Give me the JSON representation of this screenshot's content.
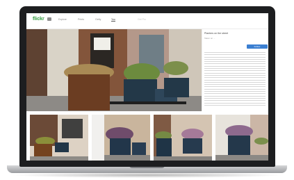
{
  "app": {
    "logo_text": "flickr"
  },
  "nav": {
    "items": [
      "Explore",
      "Prints",
      "Getty",
      "You",
      "Get Pro"
    ],
    "active_index": 3
  },
  "photo": {
    "title": "Planters on the street",
    "subtitle": "Taken on ...",
    "button_label": "Follow"
  },
  "thumbnails": [
    "thumb-1",
    "thumb-2",
    "thumb-3",
    "thumb-4"
  ],
  "colors": {
    "accent": "#3b7fd1",
    "brand": "#2f9a3d",
    "bezel": "#1d1e20"
  }
}
